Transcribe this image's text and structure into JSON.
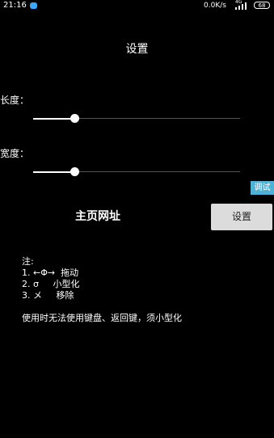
{
  "status_bar": {
    "time": "21:16",
    "network_speed": "0.0K/s",
    "network_type": "4G",
    "battery": "68"
  },
  "title": "设置",
  "length": {
    "label": "长度：",
    "value_fraction": 0.2
  },
  "width": {
    "label": "宽度：",
    "value_fraction": 0.2
  },
  "debug_button": "调试",
  "homepage_label": "主页网址",
  "set_button": "设置",
  "notes": {
    "header": "注:",
    "items": [
      "1. ←Φ→  拖动",
      "2. σ     小型化",
      "3. メ     移除"
    ]
  },
  "warning": "使用时无法使用键盘、返回键，须小型化"
}
